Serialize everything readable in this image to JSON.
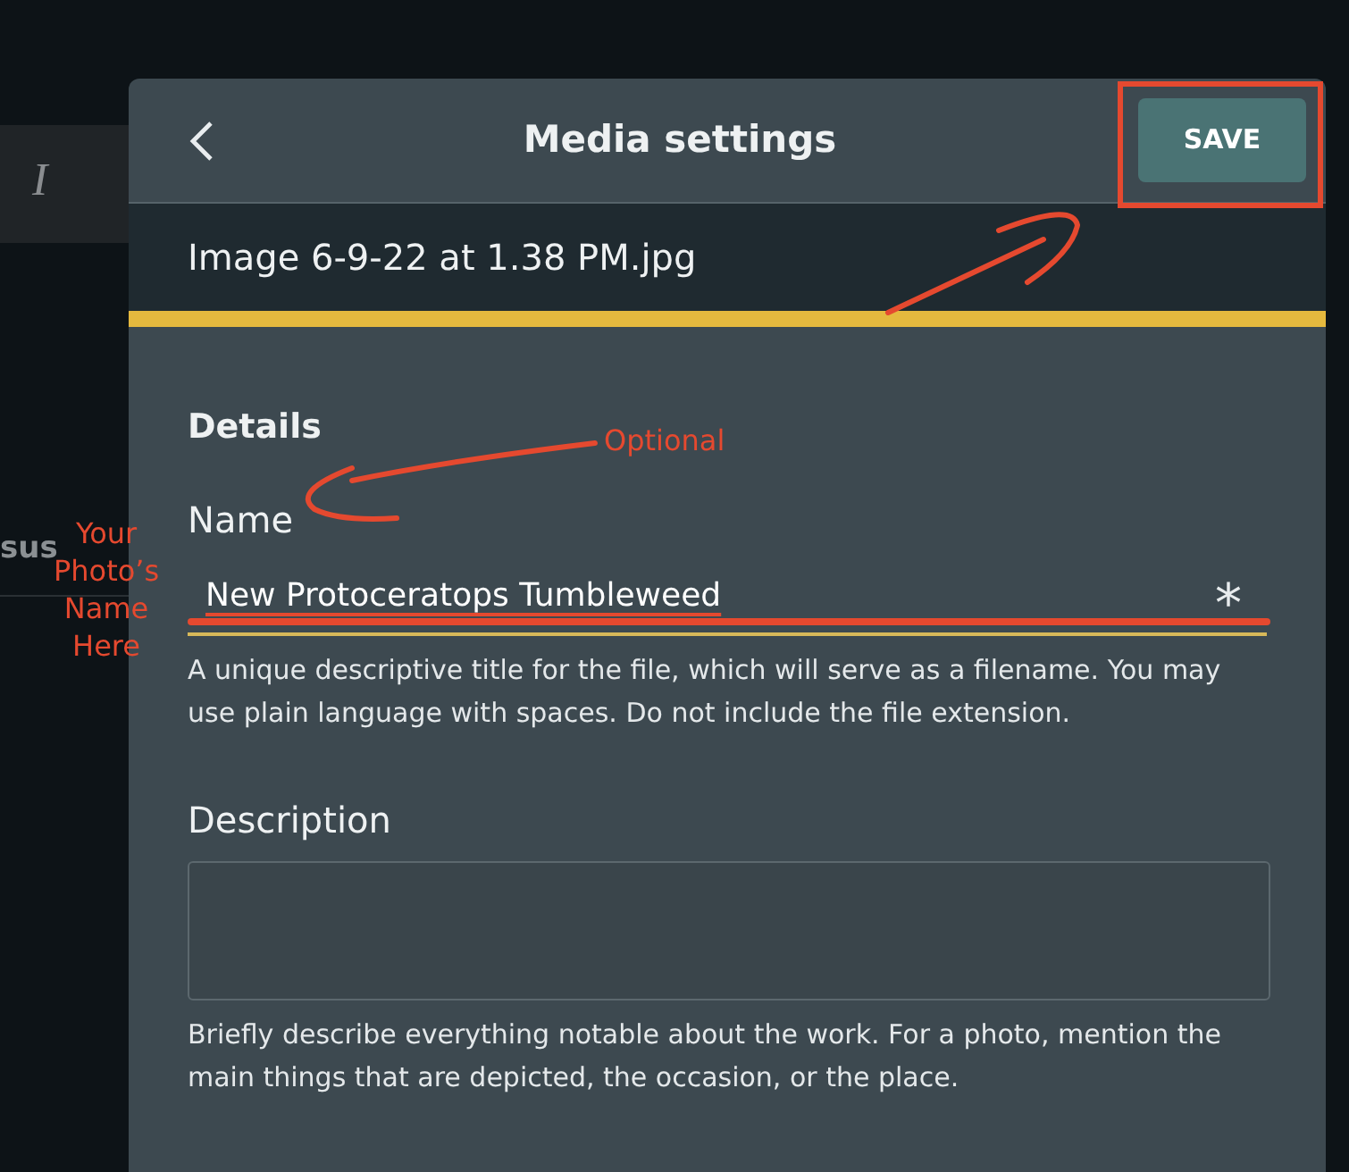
{
  "background": {
    "toolbar_glyph": "I",
    "partial_text": "sus"
  },
  "dialog": {
    "title": "Media settings",
    "save_button": "SAVE",
    "file_name": "Image 6-9-22 at 1.38 PM.jpg",
    "section": "Details",
    "fields": [
      {
        "kind": "text",
        "label": "Name",
        "value": "New Protoceratops Tumbleweed",
        "required_mark": "*",
        "help": "A unique descriptive title for the file, which will serve as a filename. You may use plain language with spaces. Do not include the file extension."
      },
      {
        "kind": "textarea",
        "label": "Description",
        "help": "Briefly describe everything notable about the work. For a photo, mention the main things that are depicted, the occasion, or the place."
      }
    ]
  },
  "annotations": {
    "color": "#e5492f",
    "labels": [
      "Optional",
      "Your Photo’s Name Here"
    ]
  }
}
